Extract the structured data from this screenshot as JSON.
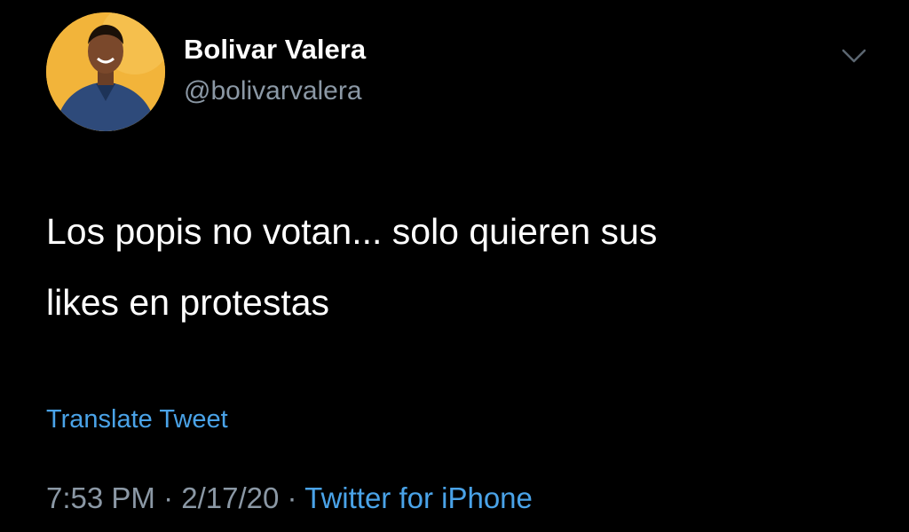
{
  "tweet": {
    "author": {
      "name": "Bolivar Valera",
      "handle": "@bolivarvalera"
    },
    "text_lines": [
      "Los popis no votan... solo quieren sus",
      "likes en protestas"
    ],
    "translate_label": "Translate Tweet",
    "time": "7:53 PM",
    "date": "2/17/20",
    "source": "Twitter for iPhone",
    "separator": "·"
  },
  "icons": {
    "avatar": "profile-photo",
    "more": "chevron-down-icon"
  },
  "colors": {
    "background": "#000000",
    "text": "#ffffff",
    "secondary": "#8b98a5",
    "link": "#4aa3e8",
    "avatar_bg": "#f2b43a"
  }
}
